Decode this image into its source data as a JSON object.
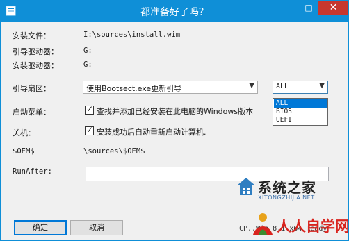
{
  "window": {
    "title": "都准备好了吗？",
    "min_glyph": "—",
    "max_glyph": "□",
    "close_glyph": "✕"
  },
  "fields": {
    "install_file_label": "安装文件：",
    "install_file_value": "I:\\sources\\install.wim",
    "boot_drive_label": "引导驱动器：",
    "boot_drive_value": "G:",
    "install_drive_label": "安装驱动器：",
    "install_drive_value": "G:",
    "boot_sector_label": "引导扇区：",
    "boot_sector_value": "使用Bootsect.exe更新引导",
    "firmware_value": "ALL",
    "firmware_options": [
      "ALL",
      "BIOS",
      "UEFI"
    ],
    "firmware_selected_index": 0,
    "boot_menu_label": "启动菜单：",
    "boot_menu_checkbox_label": "查找并添加已经安装在此电脑的Windows版本",
    "boot_menu_checked": true,
    "shutdown_label": "关机：",
    "shutdown_checkbox_label": "安装成功后自动重新启动计算机.",
    "shutdown_checked": true,
    "oem_label": "$OEM$",
    "oem_value": "\\sources\\$OEM$",
    "runafter_label": "RunAfter:",
    "runafter_value": ""
  },
  "buttons": {
    "ok_label": "确定",
    "cancel_label": "取消"
  },
  "status": {
    "text": "CP..Win 8.1 x64 Ready"
  },
  "watermarks": {
    "site_name": "系统之家",
    "site_url": "XITONGZHIJIA.NET",
    "logo2_text": "人人自学网"
  },
  "colors": {
    "title_bar": "#0f8fd7",
    "close_button": "#c7372e",
    "selection": "#0078d7"
  }
}
